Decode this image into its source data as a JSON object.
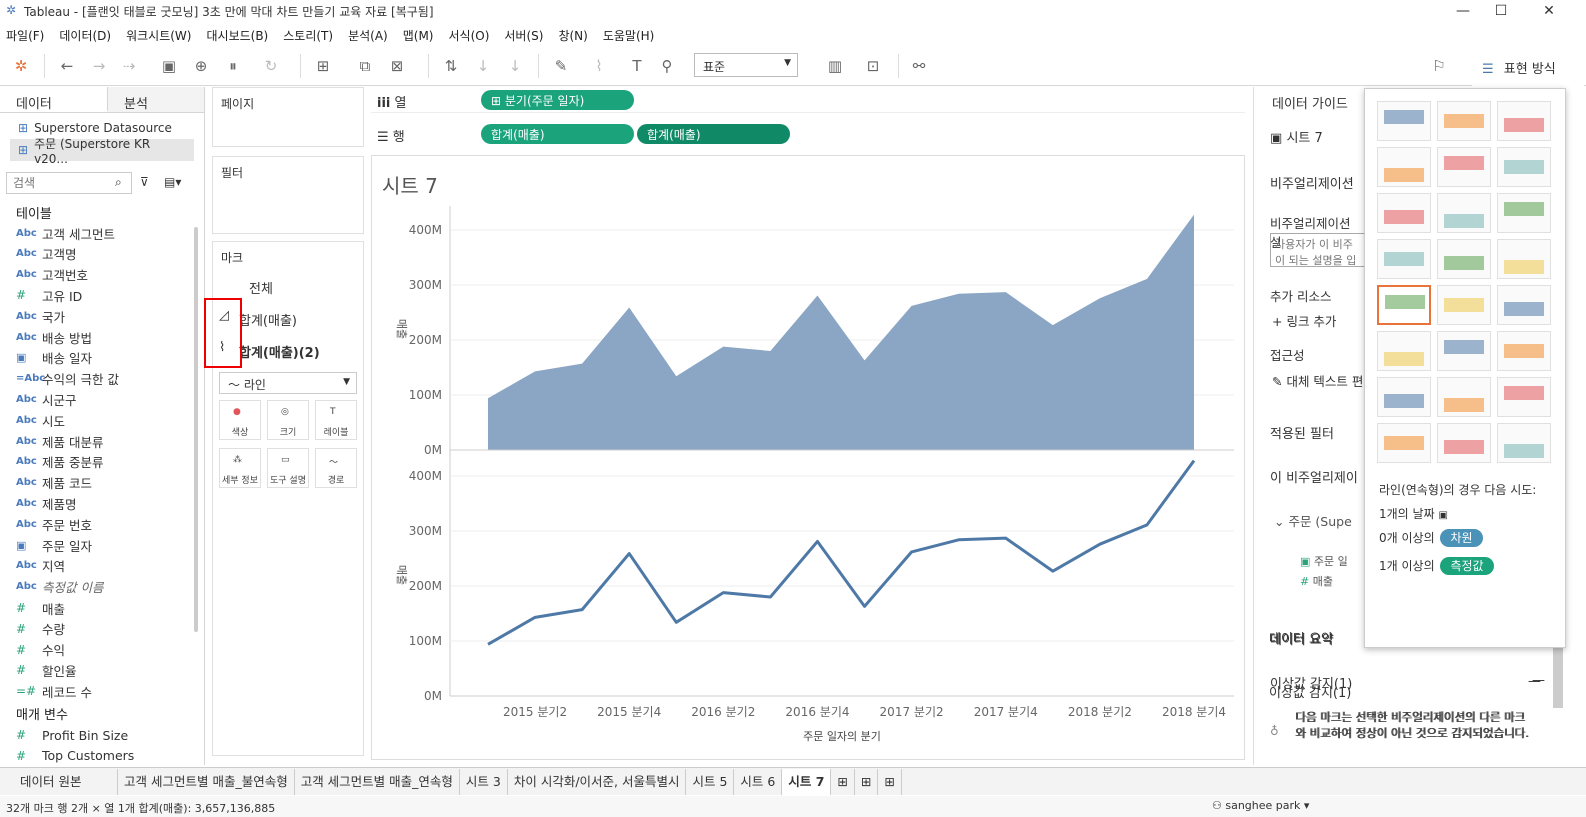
{
  "window": {
    "title": "Tableau - [플랜잇 태블로 굿모닝] 3초 만에 막대 차트 만들기 교육 자료 [복구됨]"
  },
  "menu": [
    "파일(F)",
    "데이터(D)",
    "워크시트(W)",
    "대시보드(B)",
    "스토리(T)",
    "분석(A)",
    "맵(M)",
    "서식(O)",
    "서버(S)",
    "창(N)",
    "도움말(H)"
  ],
  "toolbar": {
    "fit": "표준",
    "showme": "표현 방식"
  },
  "datapane": {
    "tab_data": "데이터",
    "tab_analytics": "분석",
    "sources": [
      "Superstore Datasource",
      "주문 (Superstore KR v20..."
    ],
    "search_placeholder": "검색",
    "tables_label": "테이블",
    "dims": [
      {
        "icon": "Abc",
        "name": "고객 세그먼트"
      },
      {
        "icon": "Abc",
        "name": "고객명"
      },
      {
        "icon": "Abc",
        "name": "고객번호"
      },
      {
        "icon": "#",
        "name": "고유 ID"
      },
      {
        "icon": "Abc",
        "name": "국가"
      },
      {
        "icon": "Abc",
        "name": "배송 방법"
      },
      {
        "icon": "cal",
        "name": "배송 일자"
      },
      {
        "icon": "=Abc",
        "name": "수익의 극한 값"
      },
      {
        "icon": "Abc",
        "name": "시군구"
      },
      {
        "icon": "Abc",
        "name": "시도"
      },
      {
        "icon": "Abc",
        "name": "제품 대분류"
      },
      {
        "icon": "Abc",
        "name": "제품 중분류"
      },
      {
        "icon": "Abc",
        "name": "제품 코드"
      },
      {
        "icon": "Abc",
        "name": "제품명"
      },
      {
        "icon": "Abc",
        "name": "주문 번호"
      },
      {
        "icon": "cal",
        "name": "주문 일자"
      },
      {
        "icon": "Abc",
        "name": "지역"
      },
      {
        "icon": "Abc",
        "name": "측정값 이름"
      }
    ],
    "measures": [
      {
        "icon": "#",
        "name": "매출"
      },
      {
        "icon": "#",
        "name": "수량"
      },
      {
        "icon": "#",
        "name": "수익"
      },
      {
        "icon": "#",
        "name": "할인율"
      },
      {
        "icon": "=#",
        "name": "레코드 수"
      }
    ],
    "params_label": "매개 변수",
    "params": [
      {
        "icon": "#",
        "name": "Profit Bin Size"
      },
      {
        "icon": "#",
        "name": "Top Customers"
      }
    ]
  },
  "shelves": {
    "pages": "페이지",
    "filters": "필터",
    "marks": "마크",
    "marks_all": "전체",
    "marks_1": "합계(매출)",
    "marks_2": "합계(매출)(2)",
    "mark_type": "라인",
    "mark_buttons": [
      "색상",
      "크기",
      "레이블",
      "세부 정보",
      "도구 설명",
      "경로"
    ],
    "columns_label": "열",
    "rows_label": "행",
    "col_pill": "⊞ 분기(주문 일자)",
    "row_pill_1": "합계(매출)",
    "row_pill_2": "합계(매출)"
  },
  "chart_data": {
    "type": "area",
    "title": "시트 7",
    "xlabel": "주문 일자의 분기",
    "ylabel": "매출",
    "categories": [
      "2015 분기1",
      "2015 분기2",
      "2015 분기3",
      "2015 분기4",
      "2016 분기1",
      "2016 분기2",
      "2016 분기3",
      "2016 분기4",
      "2017 분기1",
      "2017 분기2",
      "2017 분기3",
      "2017 분기4",
      "2018 분기1",
      "2018 분기2",
      "2018 분기3",
      "2018 분기4"
    ],
    "tick_labels": [
      "2015 분기2",
      "2015 분기4",
      "2016 분기2",
      "2016 분기4",
      "2017 분기2",
      "2017 분기4",
      "2018 분기2",
      "2018 분기4"
    ],
    "y_ticks": [
      "0M",
      "100M",
      "200M",
      "300M",
      "400M"
    ],
    "ylim": [
      0,
      440
    ],
    "series": [
      {
        "name": "합계(매출)",
        "values": [
          94,
          143,
          157,
          259,
          134,
          188,
          180,
          281,
          163,
          262,
          284,
          287,
          227,
          276,
          311,
          428
        ]
      },
      {
        "name": "합계(매출)(2)",
        "values": [
          94,
          143,
          157,
          259,
          134,
          188,
          180,
          281,
          163,
          262,
          284,
          287,
          227,
          276,
          311,
          428
        ]
      }
    ],
    "colors": {
      "area": "#8aa6c4",
      "line": "#4e79a7"
    }
  },
  "datapanel": {
    "guide": "데이터 가이드",
    "sheet": "시트 7",
    "viz_label": "비주얼리제이션",
    "viz_desc_label": "비주얼리제이션 설",
    "viz_desc_ph": "사용자가 이 비주 이 되는 설명을 입",
    "extra": "추가 리소스",
    "add_link": "링크 추가",
    "access": "접근성",
    "alt_text": "대체 텍스트 편",
    "applied": "적용된 필터",
    "this_viz": "이 비주얼리제이",
    "order": "주문 (Supe",
    "f1": "주문 일",
    "f2": "매출",
    "summary": "데이터 요약",
    "outlier": "이상값 감지(1)",
    "outlier_desc": "다음 마크는 선택한 비주얼리제이션의 다른 마크와 비교하여 정상이 아닌 것으로 감지되었습니다."
  },
  "showme": {
    "hint": "라인(연속형)의 경우 다음 시도:",
    "req1": "1개의 날짜",
    "req2_pre": "0개 이상의",
    "req2_badge": "차원",
    "req3_pre": "1개 이상의",
    "req3_badge": "측정값"
  },
  "sheettabs": [
    "데이터 원본",
    "고객 세그먼트별 매출_불연속형",
    "고객 세그먼트별 매출_연속형",
    "시트 3",
    "차이 시각화/이서준, 서울특별시",
    "시트 5",
    "시트 6",
    "시트 7"
  ],
  "status": {
    "left": "32개 마크    행 2개 × 열 1개    합계(매출): 3,657,136,885",
    "user": "sanghee park"
  }
}
